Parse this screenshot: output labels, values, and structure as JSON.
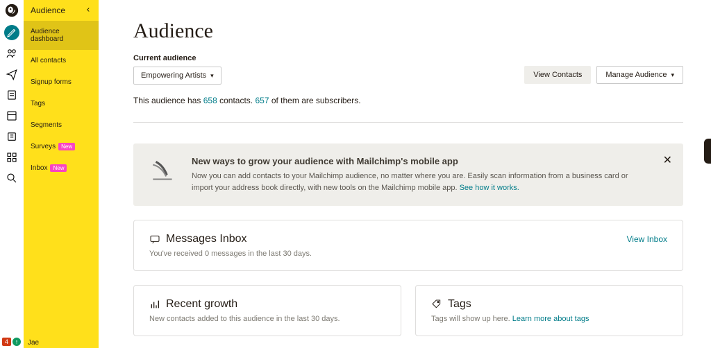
{
  "rail": {
    "icons": [
      "pencil",
      "users",
      "send",
      "doc",
      "layout",
      "survey",
      "grid",
      "search"
    ]
  },
  "sidebar": {
    "title": "Audience",
    "items": [
      {
        "label": "Audience dashboard",
        "active": true
      },
      {
        "label": "All contacts"
      },
      {
        "label": "Signup forms"
      },
      {
        "label": "Tags"
      },
      {
        "label": "Segments"
      },
      {
        "label": "Surveys",
        "badge": "New"
      },
      {
        "label": "Inbox",
        "badge": "New"
      }
    ],
    "footer_user": "Jae"
  },
  "header": {
    "title": "Audience",
    "current_label": "Current audience",
    "audience_selected": "Empowering Artists",
    "view_contacts": "View Contacts",
    "manage_audience": "Manage Audience"
  },
  "summary": {
    "prefix": "This audience has ",
    "count": "658",
    "mid": " contacts. ",
    "subs": "657",
    "suffix": " of them are subscribers."
  },
  "banner": {
    "title": "New ways to grow your audience with Mailchimp's mobile app",
    "body": "Now you can add contacts to your Mailchimp audience, no matter where you are. Easily scan information from a business card or import your address book directly, with new tools on the Mailchimp mobile app. ",
    "link": "See how it works."
  },
  "inbox_card": {
    "title": "Messages Inbox",
    "sub": "You've received 0 messages in the last 30 days.",
    "link": "View Inbox"
  },
  "growth_card": {
    "title": "Recent growth",
    "sub": "New contacts added to this audience in the last 30 days."
  },
  "tags_card": {
    "title": "Tags",
    "sub": "Tags will show up here. ",
    "link": "Learn more about tags"
  },
  "footer_badge": "4"
}
